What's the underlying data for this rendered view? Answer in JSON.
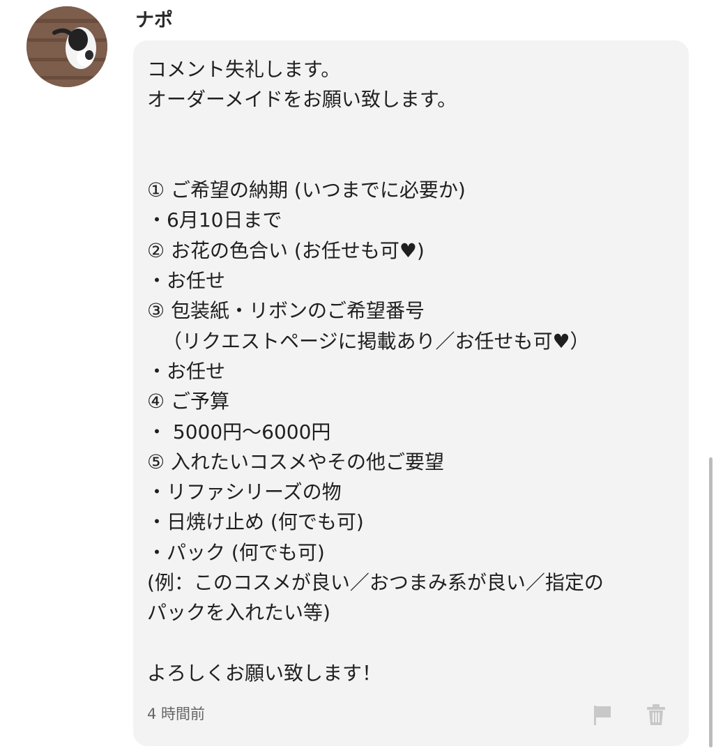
{
  "user": {
    "name": "ナポ",
    "avatar_icon": "cat-photo-avatar"
  },
  "message": {
    "lines": [
      "コメント失礼します。",
      "オーダーメイドをお願い致します。",
      "",
      "",
      "① ご希望の納期 (いつまでに必要か)",
      "・6月10日まで",
      "② お花の色合い (お任せも可♥)",
      "・お任せ",
      "③ 包装紙・リボンのご希望番号",
      "（リクエストページに掲載あり／お任せも可♥）",
      "・お任せ",
      "④ ご予算",
      "・ 5000円〜6000円",
      "⑤ 入れたいコスメやその他ご要望",
      "・リファシリーズの物",
      "・日焼け止め (何でも可)",
      "・パック (何でも可)",
      "(例：このコスメが良い／おつまみ系が良い／指定の",
      "パックを入れたい等)",
      "",
      "よろしくお願い致します！"
    ],
    "timestamp": "4 時間前"
  },
  "actions": {
    "report_icon": "flag-icon",
    "delete_icon": "trash-icon"
  },
  "colors": {
    "bubble_bg": "#f3f3f3",
    "text": "#1f1f1f",
    "meta_text": "#666666",
    "icon": "#c8c8c8"
  }
}
